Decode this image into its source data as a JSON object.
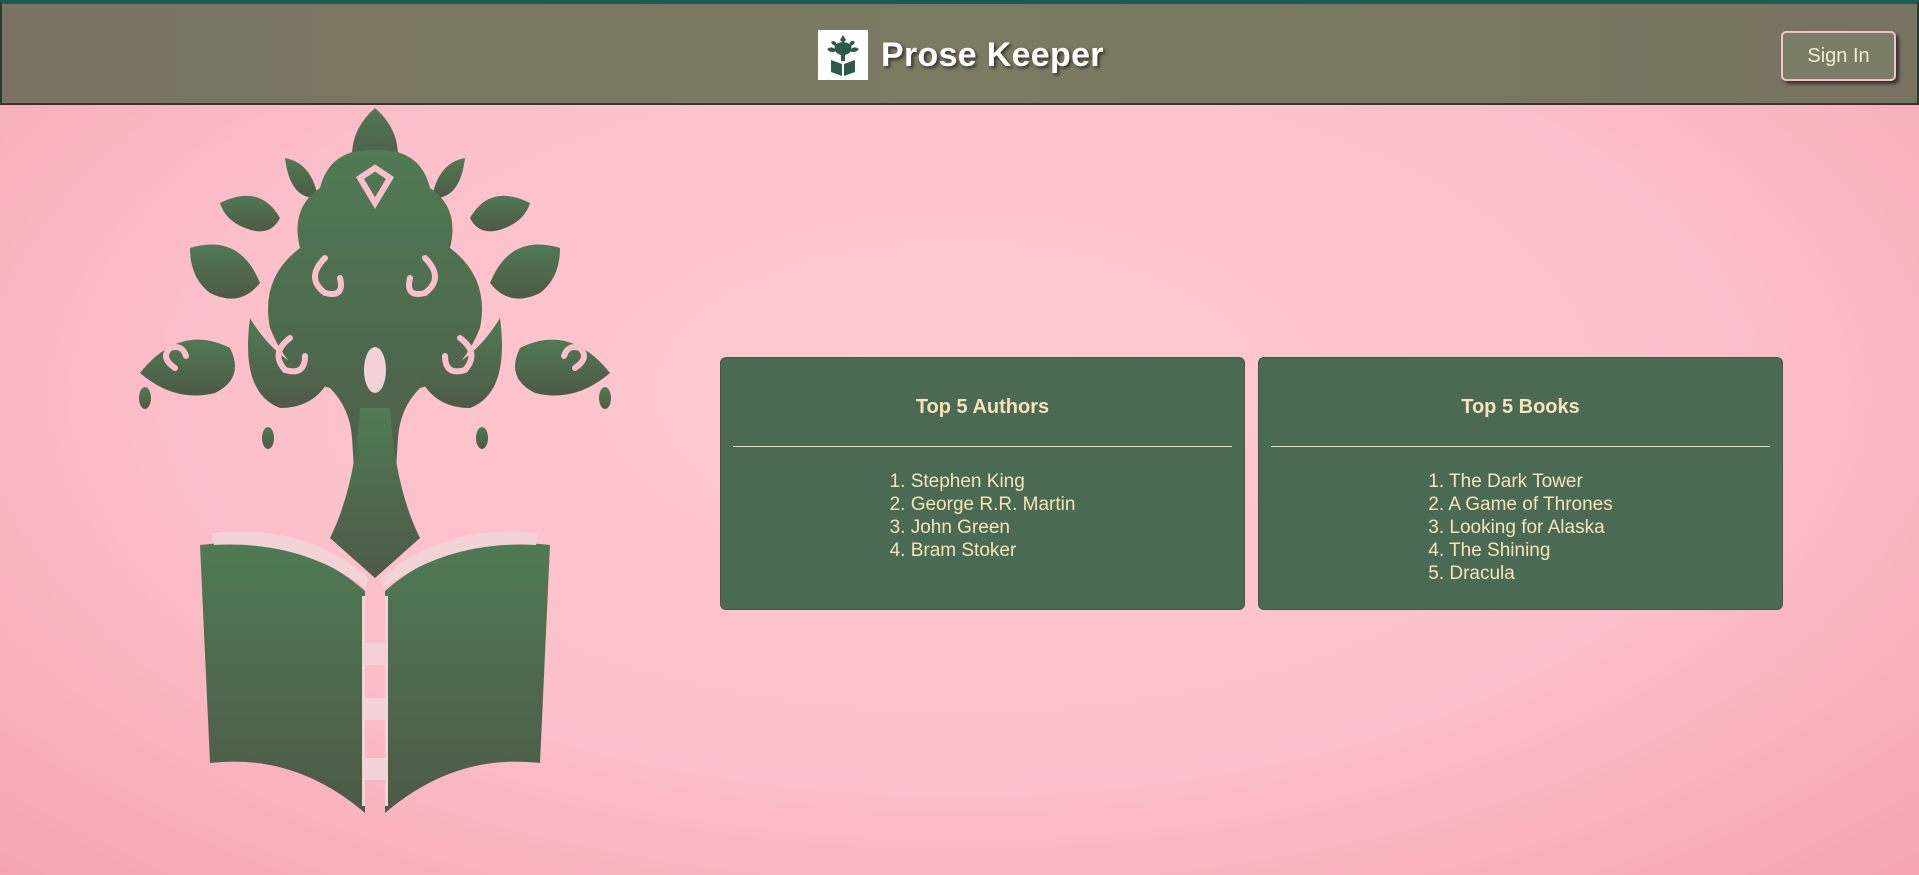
{
  "header": {
    "title": "Prose Keeper",
    "logo_icon": "tree-book-logo-icon",
    "sign_in_label": "Sign In"
  },
  "hero": {
    "logo_icon": "tree-book-logo-icon"
  },
  "cards": {
    "authors": {
      "title": "Top 5 Authors",
      "items": [
        "1. Stephen King",
        "2. George R.R. Martin",
        "3. John Green",
        "4. Bram Stoker"
      ]
    },
    "books": {
      "title": "Top 5 Books",
      "items": [
        "1. The Dark Tower",
        "2. A Game of Thrones",
        "3. Looking for Alaska",
        "4. The Shining",
        "5. Dracula"
      ]
    }
  },
  "colors": {
    "header_bg": "#7a7762",
    "page_bg": "#fdc0cb",
    "card_bg": "#4b6a53",
    "card_text": "#f6e4b8",
    "logo_green": "#4e7451"
  }
}
